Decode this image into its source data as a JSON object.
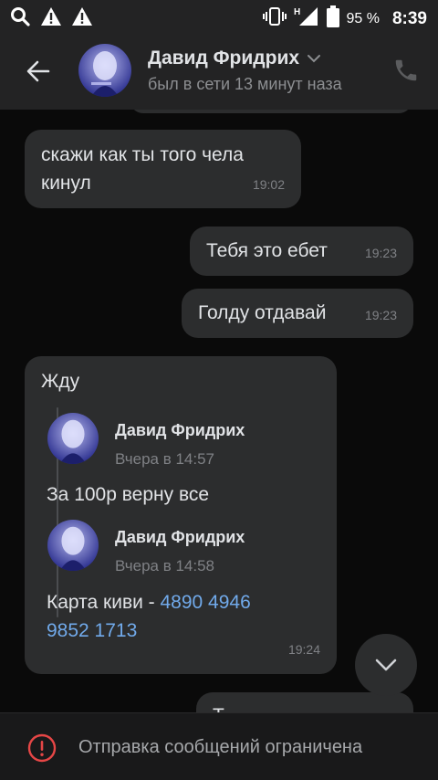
{
  "status_bar": {
    "icons": [
      "search-icon",
      "warning-icon",
      "warning-icon",
      "vibrate-icon",
      "signal-h-icon",
      "battery-icon"
    ],
    "battery": "95 %",
    "time": "8:39"
  },
  "header": {
    "contact_name": "Давид Фридрих",
    "last_seen": "был в сети 13 минут наза",
    "back_icon": "arrow-left-icon",
    "call_icon": "phone-icon",
    "dropdown_icon": "chevron-down-icon"
  },
  "messages": [
    {
      "text_line1": "скажи как ты того чела",
      "text_line2": "кинул",
      "time": "19:02",
      "direction": "incoming"
    },
    {
      "text": "Тебя это ебет",
      "time": "19:23",
      "direction": "outgoing"
    },
    {
      "text": "Голду отдавай",
      "time": "19:23",
      "direction": "outgoing"
    },
    {
      "text": "Жду",
      "time": "19:24",
      "direction": "incoming",
      "forwarded": [
        {
          "name": "Давид Фридрих",
          "date": "Вчера в 14:57",
          "text": "За 100р верну все"
        },
        {
          "name": "Давид Фридрих",
          "date": "Вчера в 14:58",
          "text_prefix": "Карта киви - ",
          "link_part1": "4890 4946",
          "link_part2": "9852 1713"
        }
      ]
    },
    {
      "text": "Т ",
      "direction": "outgoing"
    }
  ],
  "bottom": {
    "restriction_text": "Отправка сообщений ограничена",
    "icon": "alert-circle-icon"
  },
  "colors": {
    "background": "#0a0a0a",
    "bar": "#232324",
    "bubble": "#2c2d2e",
    "link": "#71aaeb",
    "alert": "#e64646"
  }
}
